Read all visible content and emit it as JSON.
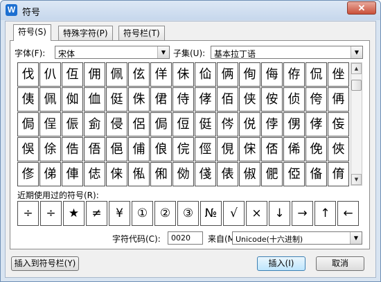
{
  "window": {
    "title": "符号",
    "close_label": "✕",
    "app_icon_glyph": "W"
  },
  "tabs": [
    {
      "label": "符号(S)",
      "active": true
    },
    {
      "label": "特殊字符(P)",
      "active": false
    },
    {
      "label": "符号栏(T)",
      "active": false
    }
  ],
  "font": {
    "label": "字体(F):",
    "value": "宋体"
  },
  "subset": {
    "label": "子集(U):",
    "value": "基本拉丁语"
  },
  "symbols": [
    [
      "伐",
      "仈",
      "仾",
      "佣",
      "佩",
      "伭",
      "佯",
      "佅",
      "佡",
      "俩",
      "侚",
      "侮",
      "侟",
      "侃",
      "侳"
    ],
    [
      "侇",
      "佩",
      "侞",
      "侐",
      "侹",
      "侏",
      "侰",
      "侍",
      "侾",
      "佰",
      "侠",
      "侒",
      "侦",
      "侉",
      "侢"
    ],
    [
      "侷",
      "侱",
      "侲",
      "侴",
      "侵",
      "侶",
      "侷",
      "侸",
      "侹",
      "侺",
      "侻",
      "侼",
      "侽",
      "侾",
      "侫"
    ],
    [
      "俁",
      "俆",
      "俈",
      "俉",
      "俋",
      "俌",
      "俍",
      "俒",
      "俓",
      "俔",
      "俕",
      "俖",
      "俙",
      "俛",
      "俠"
    ],
    [
      "俢",
      "俤",
      "俥",
      "俧",
      "俫",
      "俬",
      "俰",
      "俲",
      "俴",
      "俵",
      "俶",
      "俷",
      "俹",
      "俻",
      "俼"
    ]
  ],
  "recent": {
    "label": "近期使用过的符号(R):",
    "items": [
      "÷",
      "÷",
      "★",
      "≠",
      "¥",
      "①",
      "②",
      "③",
      "№",
      "√",
      "×",
      "↓",
      "→",
      "↑",
      "←"
    ]
  },
  "code": {
    "label": "字符代码(C):",
    "value": "0020",
    "from_label": "来自(M)",
    "from_value": "Unicode(十六进制)"
  },
  "buttons": {
    "insert_to_bar": "插入到符号栏(Y)",
    "insert": "插入(I)",
    "cancel": "取消"
  },
  "colors": {
    "title_bg": "#c6d7ec",
    "client_bg": "#f0f0f0",
    "close_red": "#c9503a"
  }
}
